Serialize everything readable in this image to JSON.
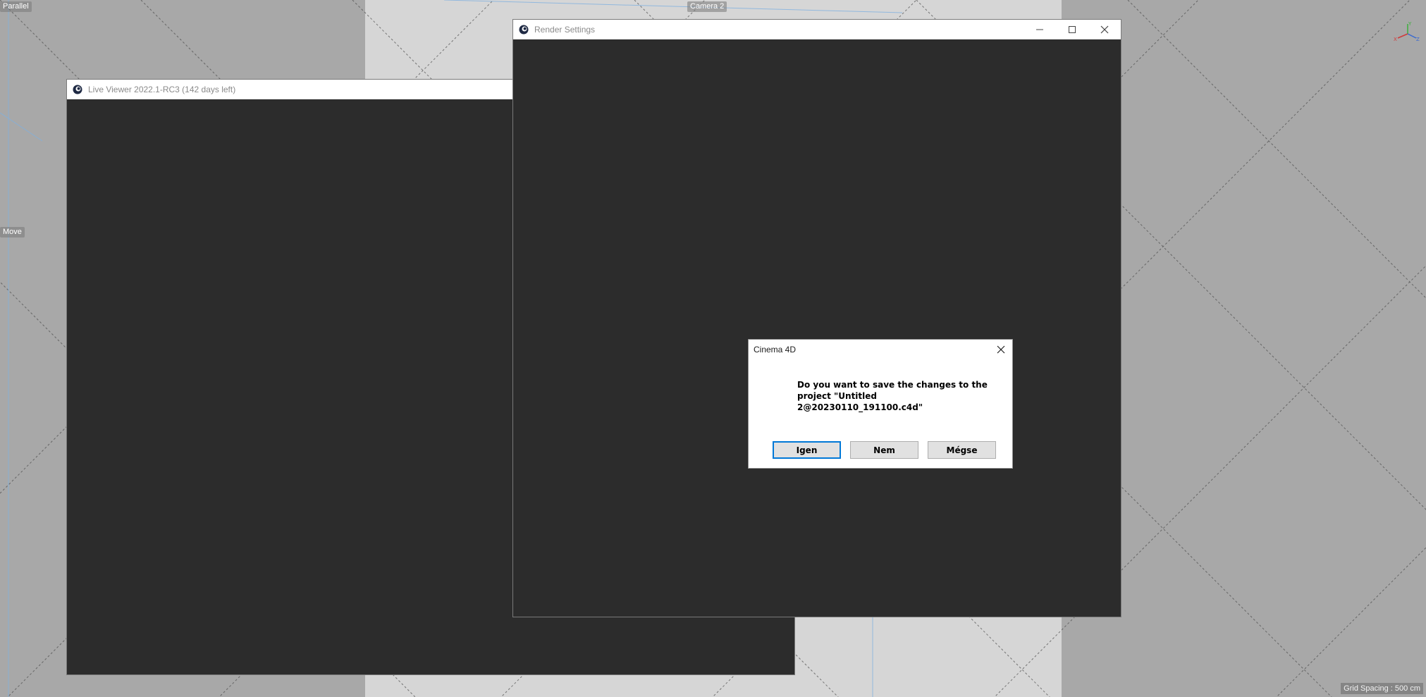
{
  "viewport": {
    "projection_label": "Parallel",
    "camera_label": "Camera 2",
    "tool_label": "Move",
    "grid_spacing_label": "Grid Spacing : 500 cm",
    "axis_labels": {
      "x": "X",
      "y": "Y",
      "z": "Z"
    },
    "background_color": "#a8a8a8",
    "center_pane_color": "#d6d6d6",
    "icons": [
      "axis-gizmo-icon"
    ]
  },
  "live_viewer": {
    "title": "Live Viewer 2022.1-RC3 (142 days left)",
    "icon": "cinema4d-logo-icon"
  },
  "render_settings": {
    "title": "Render Settings",
    "controls": [
      "minimize-icon",
      "maximize-icon",
      "close-icon"
    ],
    "icon": "cinema4d-logo-icon"
  },
  "dialog": {
    "title": "Cinema 4D",
    "message_lines": [
      "Do you want to save the changes to the",
      "project \"Untitled",
      "2@20230110_191100.c4d\""
    ],
    "buttons": {
      "yes": "Igen",
      "no": "Nem",
      "cancel": "Mégse"
    },
    "default_button": "yes",
    "accent_color": "#0078d7"
  }
}
